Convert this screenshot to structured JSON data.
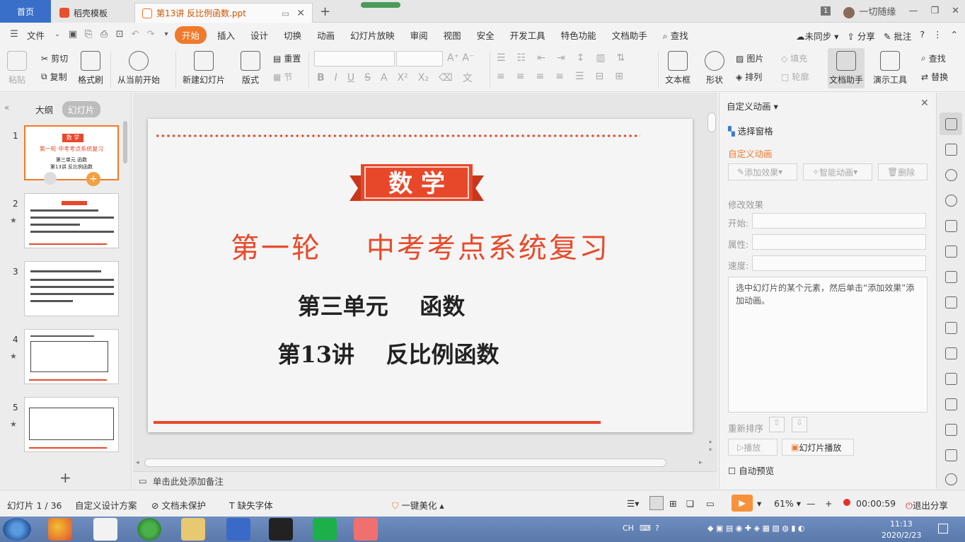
{
  "tabs": {
    "home": "首页",
    "template": "稻壳模板",
    "document": "第13讲  反比例函数.ppt",
    "badge": "1",
    "user": "一切随缘"
  },
  "menu": {
    "file": "文件",
    "items": [
      "开始",
      "插入",
      "设计",
      "切换",
      "动画",
      "幻灯片放映",
      "审阅",
      "视图",
      "安全",
      "开发工具",
      "特色功能",
      "文档助手"
    ],
    "search": "查找",
    "sync": "未同步",
    "share": "分享",
    "annotate": "批注"
  },
  "ribbon": {
    "paste": "粘贴",
    "cut": "剪切",
    "copy": "复制",
    "format_painter": "格式刷",
    "from_current": "从当前开始",
    "new_slide": "新建幻灯片",
    "layout": "版式",
    "reset": "重置",
    "section": "节",
    "textbox": "文本框",
    "shape": "形状",
    "picture": "图片",
    "arrange": "排列",
    "fill": "填充",
    "outline": "轮廓",
    "doc_helper": "文档助手",
    "present_tools": "演示工具",
    "find": "查找",
    "replace": "替换"
  },
  "left_panel": {
    "tab_outline": "大纲",
    "tab_slides": "幻灯片",
    "slide_numbers": [
      "1",
      "2",
      "3",
      "4",
      "5"
    ],
    "thumb1_badge": "数 学",
    "thumb1_title": "第一轮  中考考点系统复习",
    "thumb1_unit": "第三单元  函数",
    "thumb1_lesson": "第13讲  反比例函数"
  },
  "slide": {
    "banner": "数 学",
    "title": "第一轮    中考考点系统复习",
    "unit": "第三单元    函数",
    "lesson": "第13讲    反比例函数"
  },
  "notes": "单击此处添加备注",
  "right_panel": {
    "header": "自定义动画",
    "select_pane": "选择窗格",
    "section": "自定义动画",
    "add_effect": "添加效果",
    "smart_anim": "智能动画",
    "delete": "删除",
    "modify": "修改效果",
    "start": "开始:",
    "property": "属性:",
    "speed": "速度:",
    "hint": "选中幻灯片的某个元素，然后单击“添加效果”添加动画。",
    "reorder": "重新排序",
    "play": "播放",
    "slideshow": "幻灯片播放",
    "autopreview": "自动预览"
  },
  "status": {
    "slide_count": "幻灯片 1 / 36",
    "design": "自定义设计方案",
    "protect": "文档未保护",
    "fonts": "缺失字体",
    "beautify": "一键美化",
    "zoom": "61%",
    "timer": "00:00:59",
    "exit_share": "退出分享"
  },
  "taskbar": {
    "lang": "CH",
    "time": "11:13",
    "date": "2020/2/23"
  },
  "colors": {
    "accent": "#f07a2a",
    "slide_red": "#e8482a",
    "taskbar": "#5a78aa"
  }
}
